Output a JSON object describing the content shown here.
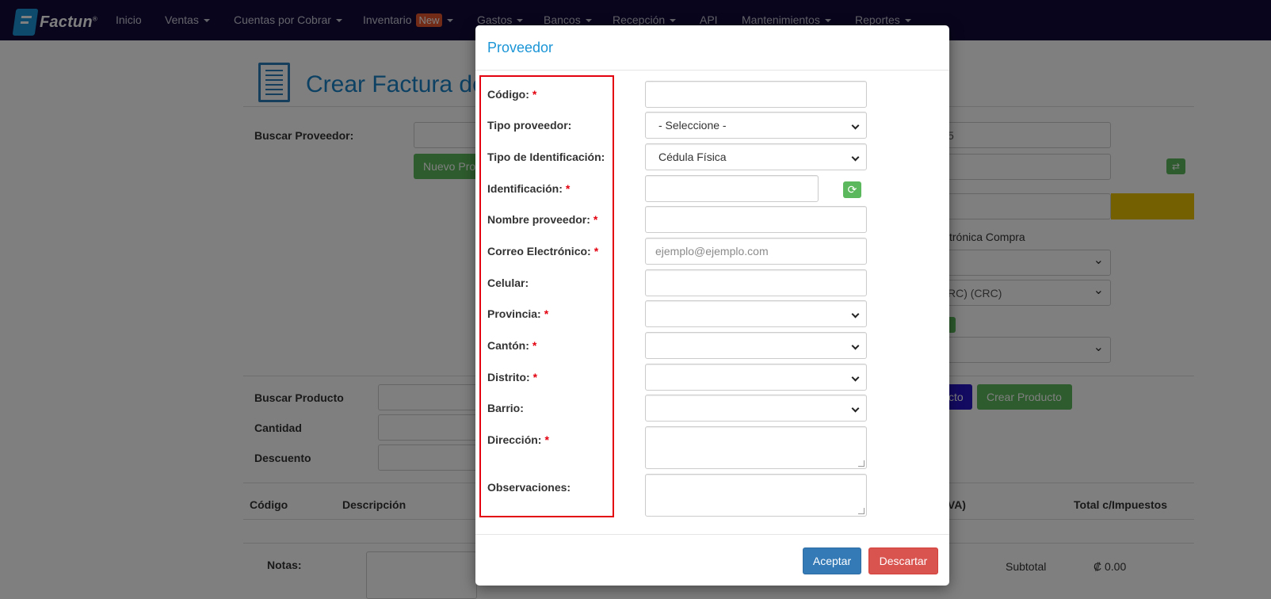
{
  "navbar": {
    "brand": "Factun",
    "brand_mark": "®",
    "items": [
      {
        "label": "Inicio",
        "caret": false
      },
      {
        "label": "Ventas",
        "caret": true
      },
      {
        "label": "Cuentas por Cobrar",
        "caret": true
      },
      {
        "label": "Inventario",
        "caret": true,
        "badge": "New"
      },
      {
        "label": "Gastos",
        "caret": true
      },
      {
        "label": "Bancos",
        "caret": true
      },
      {
        "label": "Recepción",
        "caret": true
      },
      {
        "label": "API",
        "caret": false
      },
      {
        "label": "Mantenimientos",
        "caret": true
      },
      {
        "label": "Reportes",
        "caret": true
      }
    ]
  },
  "background": {
    "page_title": "Crear Factura de",
    "buscar_proveedor_label": "Buscar Proveedor:",
    "nuevo_proveedor_btn": "Nuevo Pro",
    "right_input_partial": "5",
    "factura_tipo_partial": "ctrónica Compra",
    "moneda_partial": "RC) (CRC)",
    "buscar_producto_label": "Buscar Producto",
    "cantidad_label": "Cantidad",
    "descuento_label": "Descuento",
    "buscar_producto_btn_partial": "cto",
    "crear_producto_btn": "Crear Producto",
    "table_headers": {
      "codigo": "Código",
      "descripcion": "Descripción",
      "iva_partial": "IVA)",
      "total": "Total c/Impuestos"
    },
    "notas_label": "Notas:",
    "subtotal_label": "Subtotal",
    "subtotal_value": "₡ 0.00"
  },
  "modal": {
    "title": "Proveedor",
    "fields": {
      "codigo": {
        "label": "Código:",
        "required": "*",
        "value": ""
      },
      "tipo_proveedor": {
        "label": "Tipo proveedor:",
        "selected": "- Seleccione -"
      },
      "tipo_identificacion": {
        "label": "Tipo de Identificación:",
        "selected": "Cédula Física"
      },
      "identificacion": {
        "label": "Identificación:",
        "required": "*",
        "value": ""
      },
      "nombre_proveedor": {
        "label": "Nombre proveedor:",
        "required": "*",
        "value": ""
      },
      "correo": {
        "label": "Correo Electrónico:",
        "required": "*",
        "placeholder": "ejemplo@ejemplo.com"
      },
      "celular": {
        "label": "Celular:",
        "value": ""
      },
      "provincia": {
        "label": "Provincia:",
        "required": "*",
        "selected": ""
      },
      "canton": {
        "label": "Cantón:",
        "required": "*",
        "selected": ""
      },
      "distrito": {
        "label": "Distrito:",
        "required": "*",
        "selected": ""
      },
      "barrio": {
        "label": "Barrio:",
        "selected": ""
      },
      "direccion": {
        "label": "Dirección:",
        "required": "*",
        "value": ""
      },
      "observaciones": {
        "label": "Observaciones:",
        "value": ""
      }
    },
    "accept_label": "Aceptar",
    "discard_label": "Descartar"
  },
  "colors": {
    "navbar_bg": "#120b3b",
    "accent": "#1b95d6",
    "required": "#e3000f",
    "primary_btn": "#337ab7",
    "danger_btn": "#d9534f",
    "success_btn": "#5cb85c",
    "highlight": "#e3000f"
  },
  "icons": {
    "brand": "factun-logo-icon",
    "refresh": "refresh-icon",
    "exchange": "exchange-icon",
    "document": "document-icon"
  }
}
